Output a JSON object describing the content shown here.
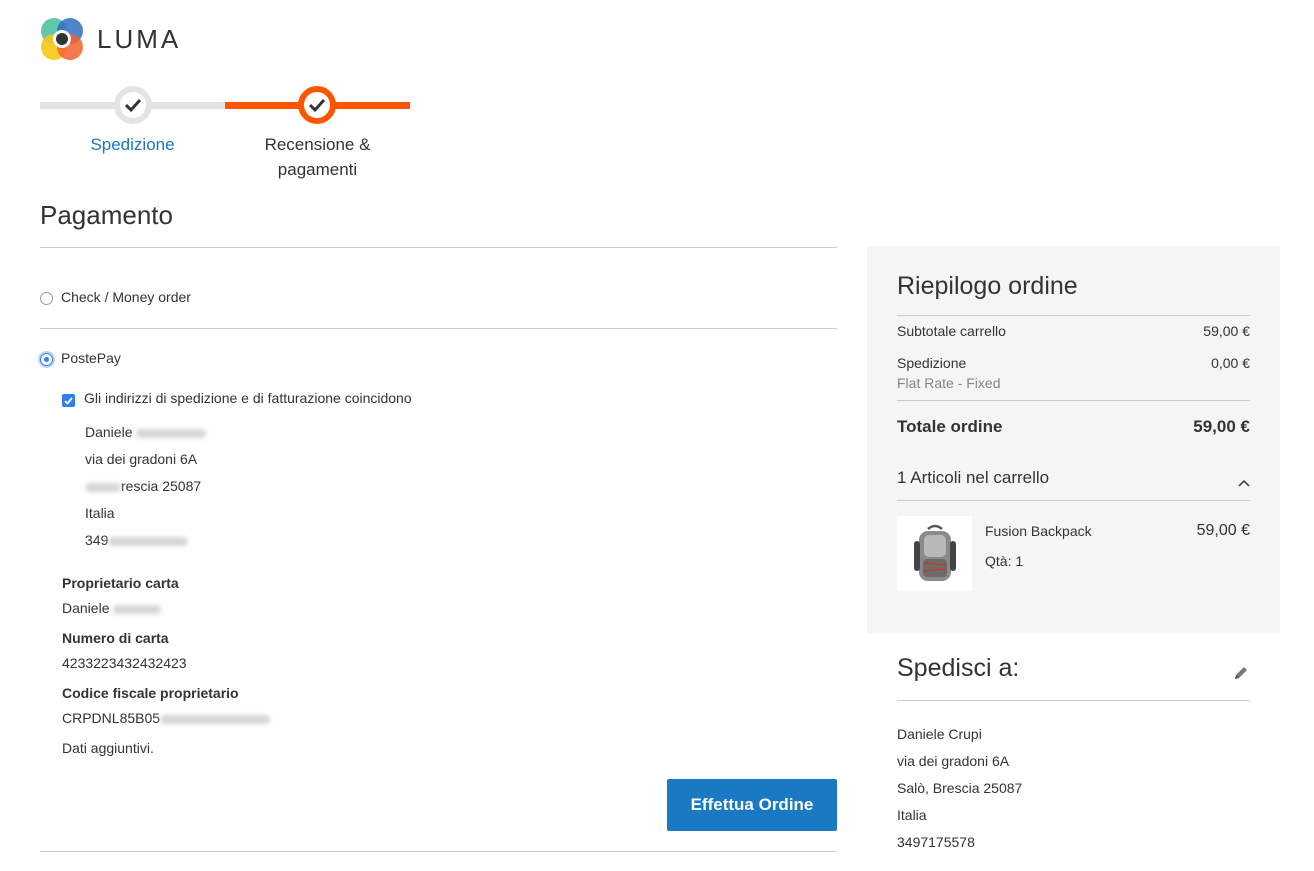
{
  "brand": {
    "name": "LUMA"
  },
  "progress": {
    "steps": [
      {
        "label": "Spedizione"
      },
      {
        "label_line1": "Recensione &",
        "label_line2": "pagamenti"
      }
    ]
  },
  "payment": {
    "title": "Pagamento",
    "methods": [
      {
        "label": "Check / Money order",
        "selected": false
      },
      {
        "label": "PostePay",
        "selected": true
      }
    ],
    "same_address_label": "Gli indirizzi di spedizione e di fatturazione coincidono",
    "address": {
      "name_visible": "Daniele",
      "street": "via dei gradoni 6A",
      "city_visible": "rescia 25087",
      "country": "Italia",
      "phone_visible": "349"
    },
    "card_owner_label": "Proprietario carta",
    "card_owner_value": "Daniele",
    "card_number_label": "Numero di carta",
    "card_number_value": "4233223432432423",
    "fiscal_code_label": "Codice fiscale proprietario",
    "fiscal_code_value": "CRPDNL85B05",
    "extra_data": "Dati aggiuntivi.",
    "place_order_label": "Effettua Ordine"
  },
  "summary": {
    "title": "Riepilogo ordine",
    "subtotal_label": "Subtotale carrello",
    "subtotal_value": "59,00 €",
    "shipping_label": "Spedizione",
    "shipping_method": "Flat Rate - Fixed",
    "shipping_value": "0,00 €",
    "total_label": "Totale ordine",
    "total_value": "59,00 €",
    "items_label": "1 Articoli nel carrello",
    "item": {
      "name": "Fusion Backpack",
      "qty": "Qtà: 1",
      "price": "59,00 €"
    }
  },
  "ship_to": {
    "title": "Spedisci a:",
    "name": "Daniele Crupi",
    "street": "via dei gradoni 6A",
    "city": "Salò, Brescia 25087",
    "country": "Italia",
    "phone": "3497175578"
  }
}
